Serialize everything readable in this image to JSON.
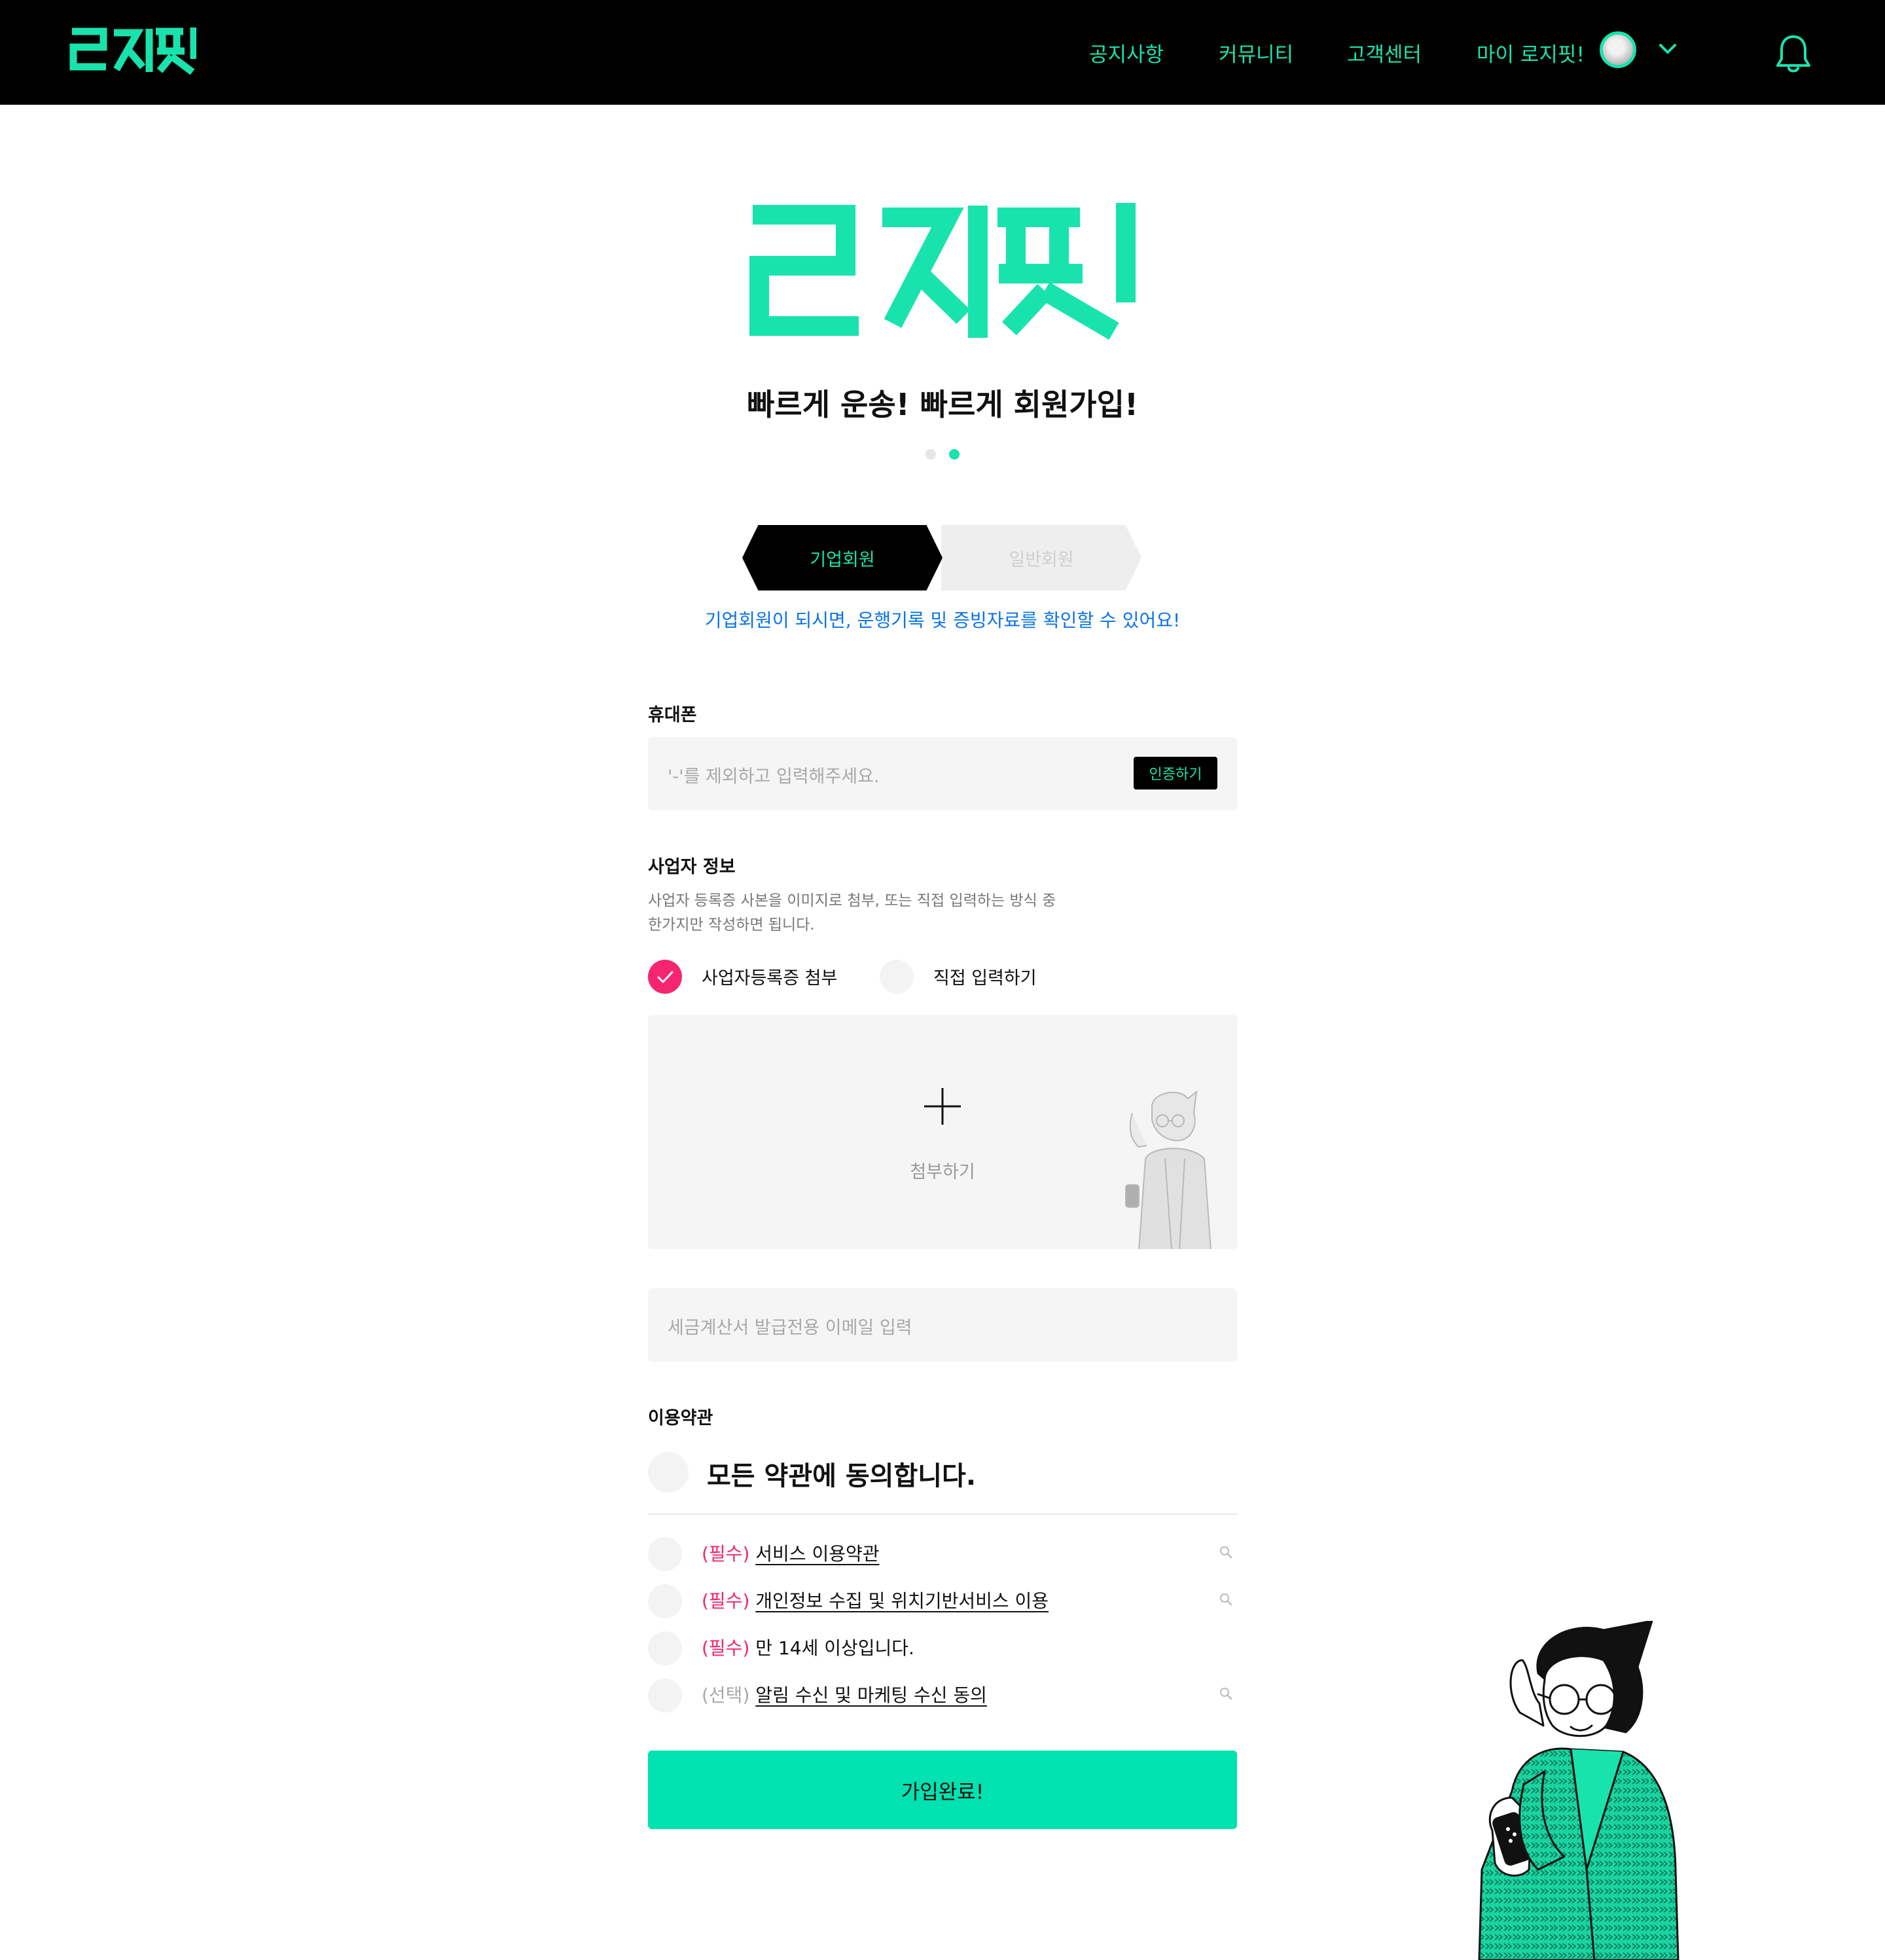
{
  "brand": {
    "name": "로지핏",
    "accent_color": "#19e3ac",
    "button_color": "#00e2b0",
    "required_color": "#f5256f",
    "info_color": "#0a73e8"
  },
  "nav": {
    "items": [
      "공지사항",
      "커뮤니티",
      "고객센터",
      "마이 로지핏!"
    ],
    "icons": [
      "user-avatar",
      "chevron-down-icon",
      "bell-icon"
    ]
  },
  "hero": {
    "tagline": "빠르게 운송! 빠르게 회원가입!",
    "carousel": {
      "total": 2,
      "active": 2
    }
  },
  "member_tabs": {
    "selected": "기업회원",
    "items": [
      "기업회원",
      "일반회원"
    ],
    "note": "기업회원이 되시면, 운행기록 및 증빙자료를 확인할 수 있어요!"
  },
  "phone": {
    "label": "휴대폰",
    "placeholder": "'-'를 제외하고 입력해주세요.",
    "verify_button": "인증하기"
  },
  "business": {
    "label": "사업자 정보",
    "desc_line1": "사업자 등록증 사본을 이미지로 첨부, 또는 직접 입력하는 방식 중",
    "desc_line2": "한가지만 작성하면 됩니다.",
    "options": [
      {
        "label": "사업자등록증 첨부",
        "checked": true
      },
      {
        "label": "직접 입력하기",
        "checked": false
      }
    ],
    "upload_label": "첨부하기",
    "email_placeholder": "세금계산서 발급전용 이메일 입력"
  },
  "terms": {
    "label": "이용약관",
    "agree_all": "모든 약관에 동의합니다.",
    "items": [
      {
        "tag": "(필수)",
        "text": "서비스 이용약관",
        "link": true
      },
      {
        "tag": "(필수)",
        "text": "개인정보 수집 및 위치기반서비스 이용",
        "link": true
      },
      {
        "tag": "(필수)",
        "text": "만 14세 이상입니다.",
        "link": false
      },
      {
        "tag": "(선택)",
        "text": "알림 수신 및 마케팅 수신 동의",
        "link": true
      }
    ]
  },
  "submit": {
    "label": "가입완료!"
  }
}
